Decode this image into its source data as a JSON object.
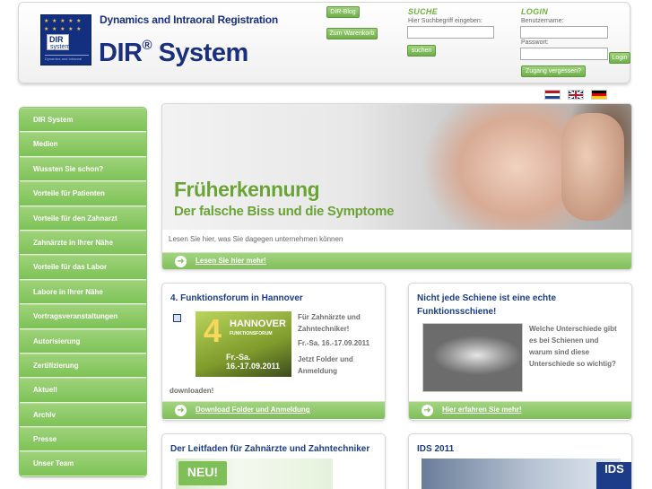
{
  "header": {
    "logo": {
      "mark_dir": "DIR",
      "mark_system": "system",
      "fine_print": "Dynamics and Intraoral Registration"
    },
    "tagline": "Dynamics and Intraoral Registration",
    "brand": "DIR",
    "brand_reg": "®",
    "brand_suffix": "System",
    "links": {
      "blog": "DIR-Blog",
      "cart": "Zum Warenkorb"
    },
    "search": {
      "heading": "SUCHE",
      "label": "Hier Suchbegriff eingeben:",
      "value": "",
      "button": "suchen"
    },
    "login": {
      "heading": "LOGIN",
      "user_label": "Benutzername:",
      "user_value": "",
      "pass_label": "Passwort:",
      "pass_value": "",
      "button": "Login",
      "forgot": "Zugang vergessen?"
    }
  },
  "flags": [
    "netherlands-flag-icon",
    "uk-flag-icon",
    "germany-flag-icon"
  ],
  "sidebar": {
    "items": [
      {
        "label": "DIR System"
      },
      {
        "label": "Medien"
      },
      {
        "label": "Wussten Sie schon?"
      },
      {
        "label": "Vorteile für Patienten"
      },
      {
        "label": "Vorteile für den Zahnarzt"
      },
      {
        "label": "Zahnärzte in Ihrer Nähe"
      },
      {
        "label": "Vorteile für das Labor"
      },
      {
        "label": "Labore in Ihrer Nähe"
      },
      {
        "label": "Vortragsveranstaltungen"
      },
      {
        "label": "Autorisierung"
      },
      {
        "label": "Zertifizierung"
      },
      {
        "label": "Aktuell"
      },
      {
        "label": "Archiv"
      },
      {
        "label": "Presse"
      },
      {
        "label": "Unser Team"
      }
    ]
  },
  "hero": {
    "title": "Früherkennung",
    "subtitle": "Der falsche Biss und die Symptome",
    "text": "Lesen Sie hier, was Sie dagegen unternehmen können",
    "link": "Lesen Sie hier mehr!"
  },
  "cards": {
    "hannover": {
      "title": "4. Funktionsforum in Hannover",
      "img_number": "4",
      "img_city": "HANNOVER",
      "img_forum": "FUNKTIONSFORUM",
      "img_day": "Fr.-Sa.",
      "img_date": "16.-17.09.2011",
      "text1": "Für Zahnärzte und",
      "text2": "Zahntechniker!",
      "text3": "Fr.-Sa. 16.-17.09.2011",
      "text4": "Jetzt Folder und",
      "text5": "Anmeldung",
      "text6": "downloaden!",
      "link": "Download Folder und Anmeldung"
    },
    "schiene": {
      "title1": "Nicht jede Schiene ist eine echte",
      "title2": "Funktionsschiene!",
      "text1": "Welche Unterschiede gibt",
      "text2": "es bei Schienen und",
      "text3": "warum sind diese",
      "text4": "Unterschiede so wichtig?",
      "link": "Hier erfahren Sie mehr!"
    },
    "leitfaden": {
      "title": "Der Leitfaden für Zahnärzte und Zahntechniker",
      "badge": "NEU!"
    },
    "ids": {
      "title": "IDS 2011",
      "logo": "IDS"
    }
  }
}
